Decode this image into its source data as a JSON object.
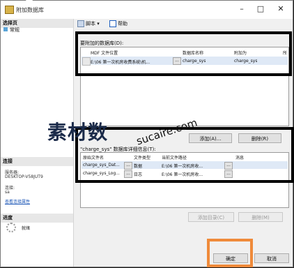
{
  "window": {
    "title": "附加数据库"
  },
  "sidebar": {
    "select_page": "选择页",
    "nav_general": "常规",
    "connection_header": "连接",
    "server_label": "服务器:",
    "server_value": "DESKTOP-V58JUT9",
    "conn_label": "连接:",
    "conn_value": "sa",
    "view_props": "查看连接属性",
    "progress_header": "进度",
    "status": "就绪"
  },
  "toolbar": {
    "script": "脚本",
    "help": "帮助"
  },
  "attach": {
    "label": "要附加的数据库(D):",
    "columns": [
      "MDF 文件位置",
      "数据库名称",
      "附加为",
      "所"
    ],
    "rows": [
      {
        "mdf": "E:\\06 第一次机房收费系统\\机...",
        "db": "charge_sys",
        "as": "charge_sys"
      }
    ]
  },
  "buttons": {
    "add": "添加(A)...",
    "remove": "删除(R)",
    "add_catalog": "添加目录(C)",
    "remove2": "删除(M)",
    "ok": "确定",
    "cancel": "取消"
  },
  "details": {
    "label": "\"charge_sys\" 数据库详细信息(T):",
    "columns": [
      "原始文件名",
      "文件类型",
      "当前文件路径",
      "消息"
    ],
    "rows": [
      {
        "file": "charge_sys_Dat...",
        "type": "数据",
        "path": "E:\\06 第一次机房收..."
      },
      {
        "file": "charge_sys_Log...",
        "type": "日志",
        "path": "E:\\06 第一次机房收..."
      }
    ]
  },
  "watermark": {
    "text1": "素材数",
    "text2": "sucaire.com"
  }
}
